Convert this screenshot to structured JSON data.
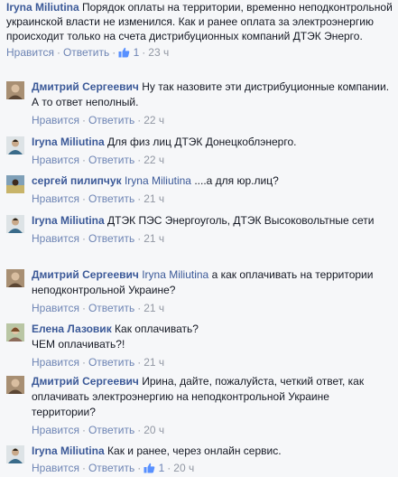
{
  "top": {
    "author": "Iryna Miliutina",
    "text": "Порядок оплаты на территории, временно неподконтрольной украинской власти не изменился. Как и ранее оплата за электроэнергию происходит только на счета дистрибуционных компаний ДТЭК Энерго.",
    "like_label": "Нравится",
    "reply_label": "Ответить",
    "like_count": "1",
    "time": "23 ч"
  },
  "replies": [
    {
      "author": "Дмитрий Сергеевич",
      "mention": "",
      "text": "Ну так назовите эти дистрибуционные компании. А то ответ неполный.",
      "like_label": "Нравится",
      "reply_label": "Ответить",
      "time": "22 ч"
    },
    {
      "author": "Iryna Miliutina",
      "mention": "",
      "text": "Для физ лиц ДТЭК Донецкоблэнерго.",
      "like_label": "Нравится",
      "reply_label": "Ответить",
      "time": "22 ч"
    },
    {
      "author": "сергей пилипчук",
      "mention": "Iryna Miliutina",
      "text": "....а для юр.лиц?",
      "like_label": "Нравится",
      "reply_label": "Ответить",
      "time": "21 ч"
    },
    {
      "author": "Iryna Miliutina",
      "mention": "",
      "text": "ДТЭК ПЭС Энергоуголь, ДТЭК Высоковольтные сети",
      "like_label": "Нравится",
      "reply_label": "Ответить",
      "time": "21 ч"
    },
    {
      "author": "Дмитрий Сергеевич",
      "mention": "Iryna Miliutina",
      "text": "а как оплачивать на территории неподконтрольной Украине?",
      "like_label": "Нравится",
      "reply_label": "Ответить",
      "time": "21 ч"
    },
    {
      "author": "Елена Лазовик",
      "mention": "",
      "text": "Как оплачивать?\nЧЕМ оплачивать?!",
      "like_label": "Нравится",
      "reply_label": "Ответить",
      "time": "21 ч"
    },
    {
      "author": "Дмитрий Сергеевич",
      "mention": "",
      "text": "Ирина, дайте, пожалуйста, четкий ответ, как оплачивать электроэнергию на неподконтрольной Украине территории?",
      "like_label": "Нравится",
      "reply_label": "Ответить",
      "time": "20 ч"
    },
    {
      "author": "Iryna Miliutina",
      "mention": "",
      "text": "Как и ранее, через онлайн сервис.",
      "like_label": "Нравится",
      "reply_label": "Ответить",
      "like_count": "1",
      "time": "20 ч"
    }
  ]
}
